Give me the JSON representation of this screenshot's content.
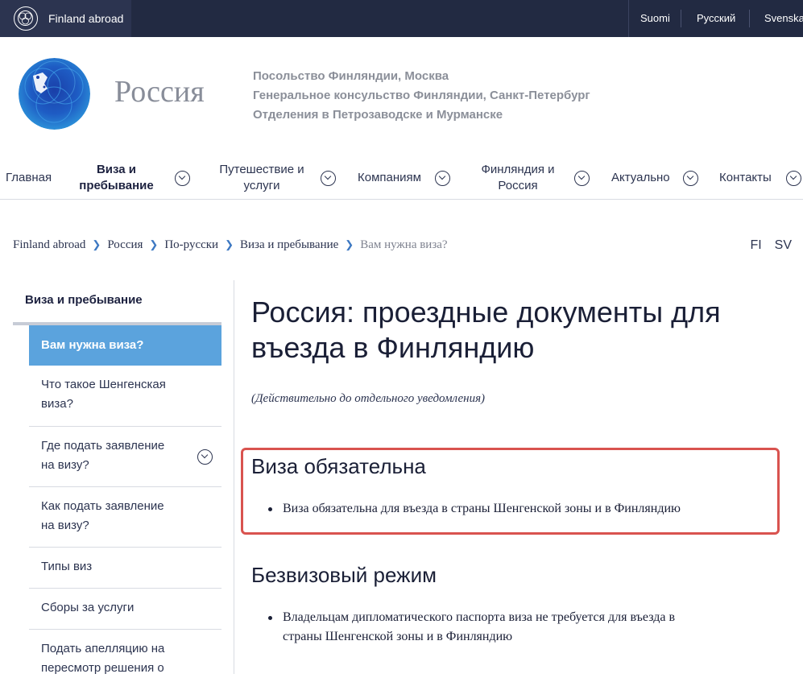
{
  "topbar": {
    "brand": "Finland abroad",
    "languages": [
      "Suomi",
      "Русский",
      "Svenska"
    ]
  },
  "header": {
    "site_name": "Россия",
    "subtitles": [
      "Посольство Финляндии, Москва",
      "Генеральное консульство Финляндии, Санкт-Петербург",
      "Отделения в Петрозаводске и Мурманске"
    ]
  },
  "nav": {
    "items": [
      {
        "line1": "Главная",
        "line2": ""
      },
      {
        "line1": "Виза и",
        "line2": "пребывание"
      },
      {
        "line1": "Путешествие и",
        "line2": "услуги"
      },
      {
        "line1": "Компаниям",
        "line2": ""
      },
      {
        "line1": "Финляндия и",
        "line2": "Россия"
      },
      {
        "line1": "Актуально",
        "line2": ""
      },
      {
        "line1": "Контакты",
        "line2": ""
      }
    ]
  },
  "breadcrumb": [
    "Finland abroad",
    "Россия",
    "По-русски",
    "Виза и пребывание",
    "Вам нужна виза?"
  ],
  "page_languages": [
    "FI",
    "SV"
  ],
  "sidebar": {
    "title": "Виза и пребывание",
    "items": [
      {
        "line1": "Вам нужна виза?",
        "line2": ""
      },
      {
        "line1": "Что такое Шенгенская",
        "line2": "виза?"
      },
      {
        "line1": "Где подать заявление",
        "line2": "на визу?"
      },
      {
        "line1": "Как подать заявление",
        "line2": "на визу?"
      },
      {
        "line1": "Типы виз",
        "line2": ""
      },
      {
        "line1": "Сборы за услуги",
        "line2": ""
      },
      {
        "line1": "Подать апелляцию на",
        "line2": "пересмотр решения о"
      }
    ]
  },
  "content": {
    "title_line1": "Россия: проездные документы для",
    "title_line2": "въезда в Финляндию",
    "note": "(Действительно до отдельного уведомления)",
    "section1": {
      "heading": "Виза обязательна",
      "bullet": "Виза обязательна для въезда в страны Шенгенской зоны и в Финляндию"
    },
    "section2": {
      "heading": "Безвизовый режим",
      "bullet_line1": "Владельцам дипломатического паспорта виза не требуется для въезда в",
      "bullet_line2": "страны Шенгенской зоны и в Финляндию"
    }
  },
  "colors": {
    "topbar": "#222a42",
    "sidebar_active": "#5ba3dd",
    "highlight_border": "#d9534f"
  }
}
